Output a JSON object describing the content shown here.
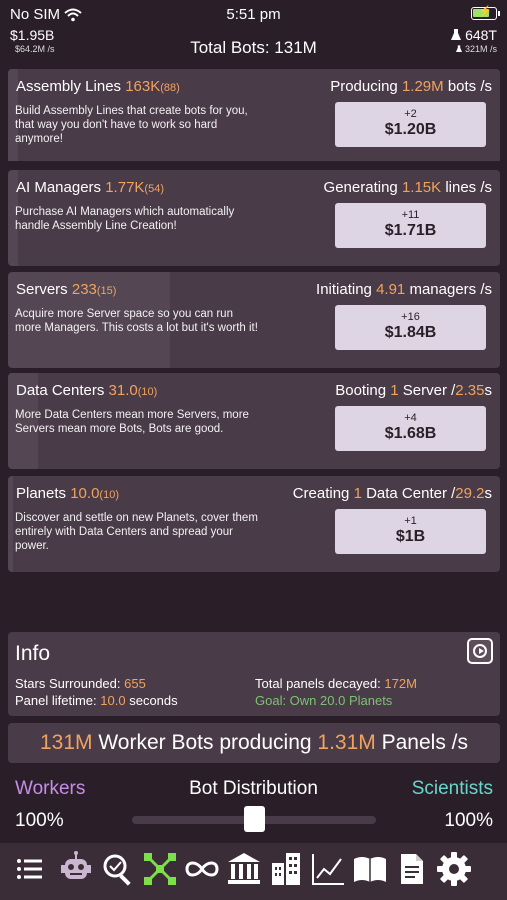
{
  "status_bar": {
    "carrier": "No SIM",
    "time": "5:51 pm"
  },
  "header": {
    "money": "$1.95B",
    "money_rate": "$64.2M /s",
    "total_bots": "Total Bots: 131M",
    "science": "648T",
    "science_rate": "321M /s",
    "science_icon": "flask-icon"
  },
  "panels": [
    {
      "name": "Assembly Lines",
      "value": "163K",
      "count": "(88)",
      "rate_prefix": "Producing",
      "rate_value": "1.29M",
      "rate_suffix": "bots /s",
      "description": "Build Assembly Lines that create bots for you, that way you don't have to work so hard anymore!",
      "buy_plus": "+2",
      "buy_price": "$1.20B",
      "progress": 0.02
    },
    {
      "name": "AI Managers",
      "value": "1.77K",
      "count": "(54)",
      "rate_prefix": "Generating",
      "rate_value": "1.15K",
      "rate_suffix": "lines /s",
      "description": "Purchase AI Managers which automatically handle Assembly Line Creation!",
      "buy_plus": "+11",
      "buy_price": "$1.71B",
      "progress": 0.02
    },
    {
      "name": "Servers",
      "value": "233",
      "count": "(15)",
      "rate_prefix": "Initiating",
      "rate_value": "4.91",
      "rate_suffix": "managers /s",
      "description": "Acquire more Server space so you can run more Managers. This costs a lot but it's worth it!",
      "buy_plus": "+16",
      "buy_price": "$1.84B",
      "progress": 0.33
    },
    {
      "name": "Data Centers",
      "value": "31.0",
      "count": "(10)",
      "rate_prefix": "Booting",
      "rate_value": "1",
      "rate_suffix": "Server /",
      "rate_time": "2.35",
      "rate_time_unit": "s",
      "description": "More Data Centers mean more Servers, more Servers mean more Bots, Bots are good.",
      "buy_plus": "+4",
      "buy_price": "$1.68B",
      "progress": 0.06
    },
    {
      "name": "Planets",
      "value": "10.0",
      "count": "(10)",
      "rate_prefix": "Creating",
      "rate_value": "1",
      "rate_suffix": "Data Center /",
      "rate_time": "29.2",
      "rate_time_unit": "s",
      "description": "Discover and settle on new Planets, cover them entirely with Data Centers and spread your power.",
      "buy_plus": "+1",
      "buy_price": "$1B",
      "progress": 0.01
    }
  ],
  "info": {
    "heading": "Info",
    "stars_label": "Stars Surrounded:",
    "stars_value": "655",
    "lifetime_label": "Panel lifetime:",
    "lifetime_value": "10.0",
    "lifetime_unit": "seconds",
    "decayed_label": "Total panels decayed:",
    "decayed_value": "172M",
    "goal": "Goal: Own 20.0 Planets"
  },
  "producing": {
    "bots": "131M",
    "middle": "Worker Bots producing",
    "panels": "1.31M",
    "suffix": "Panels /s"
  },
  "distribution": {
    "left_label": "Workers",
    "title": "Bot Distribution",
    "right_label": "Scientists",
    "left_pct": "100%",
    "right_pct": "100%",
    "slider_value": 0.5,
    "left_color": "#c58ee6",
    "right_color": "#67d7c9"
  },
  "tabs": [
    {
      "icon": "list-icon"
    },
    {
      "icon": "robot-icon"
    },
    {
      "icon": "magnifier-icon"
    },
    {
      "icon": "network-icon",
      "active": true
    },
    {
      "icon": "infinity-icon"
    },
    {
      "icon": "bank-icon"
    },
    {
      "icon": "buildings-icon"
    },
    {
      "icon": "chart-icon"
    },
    {
      "icon": "book-icon"
    },
    {
      "icon": "document-icon"
    },
    {
      "icon": "gear-icon"
    }
  ],
  "colors": {
    "accent_orange": "#f0a35e",
    "active_tab": "#7de04a",
    "goal_green": "#7cc274"
  }
}
